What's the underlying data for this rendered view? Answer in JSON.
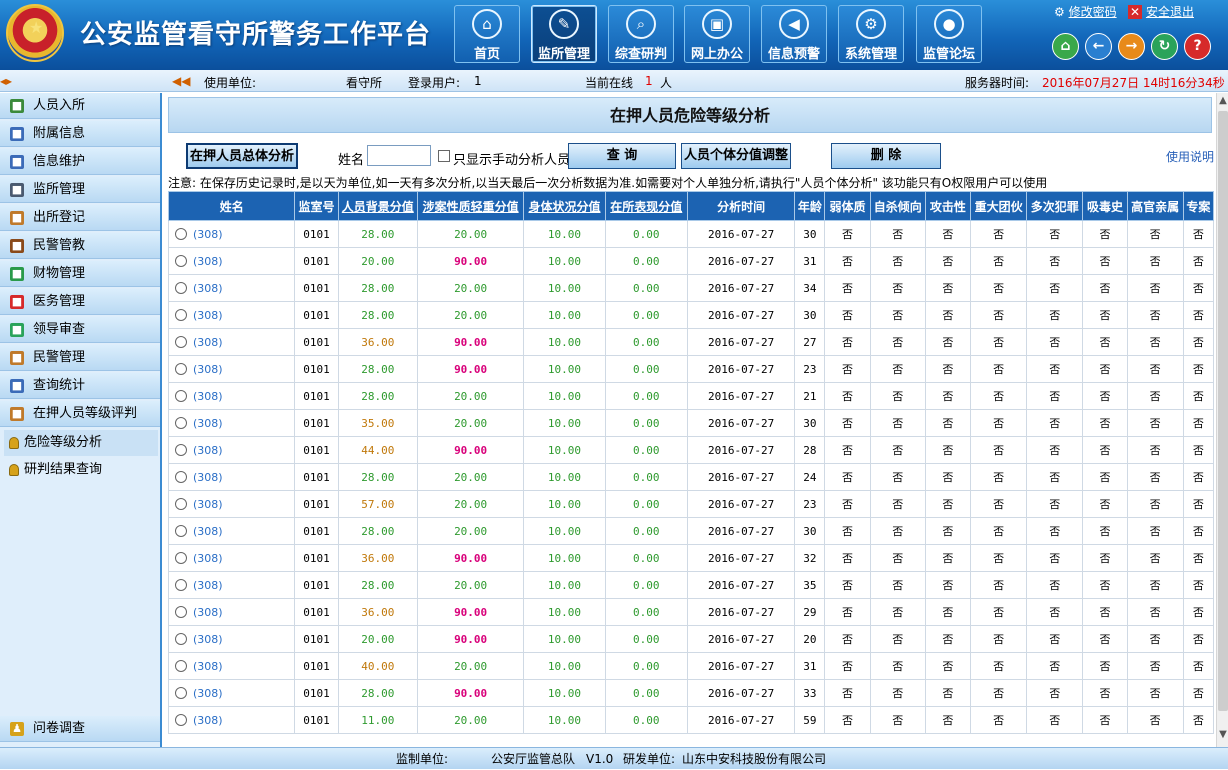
{
  "header": {
    "title": "公安监管看守所警务工作平台",
    "nav": [
      {
        "label": "首页",
        "icon": "home-icon",
        "glyph": "⌂",
        "active": false
      },
      {
        "label": "监所管理",
        "icon": "quill-icon",
        "glyph": "✎",
        "active": true
      },
      {
        "label": "综查研判",
        "icon": "magnifier-icon",
        "glyph": "⌕",
        "active": false
      },
      {
        "label": "网上办公",
        "icon": "monitor-icon",
        "glyph": "▣",
        "active": false
      },
      {
        "label": "信息预警",
        "icon": "alert-icon",
        "glyph": "◀",
        "active": false
      },
      {
        "label": "系统管理",
        "icon": "gear-icon",
        "glyph": "⚙",
        "active": false
      },
      {
        "label": "监管论坛",
        "icon": "speech-icon",
        "glyph": "●",
        "active": false
      }
    ],
    "change_password": "修改密码",
    "logout": "安全退出",
    "tools": [
      {
        "name": "home-tool-icon",
        "glyph": "⌂",
        "color": "#3aa84a"
      },
      {
        "name": "back-tool-icon",
        "glyph": "←",
        "color": "#2a7fd0"
      },
      {
        "name": "forward-tool-icon",
        "glyph": "→",
        "color": "#e88a1a"
      },
      {
        "name": "refresh-tool-icon",
        "glyph": "↻",
        "color": "#2aa35a"
      },
      {
        "name": "help-tool-icon",
        "glyph": "?",
        "color": "#d62a2a"
      }
    ]
  },
  "infobar": {
    "unit_label": "使用单位:",
    "unit_value": "看守所",
    "user_label": "登录用户:",
    "user_value": "1",
    "online_label": "当前在线",
    "online_count": "1",
    "online_unit": "人",
    "server_time_label": "服务器时间:",
    "server_time_value": "2016年07月27日 14时16分34秒"
  },
  "sidebar": {
    "items": [
      {
        "label": "人员入所",
        "icon": "person-add-icon",
        "color": "#3b8a3b"
      },
      {
        "label": "附属信息",
        "icon": "document-icon",
        "color": "#3b6bb8"
      },
      {
        "label": "信息维护",
        "icon": "contact-card-icon",
        "color": "#3b6bb8"
      },
      {
        "label": "监所管理",
        "icon": "monitor-icon",
        "color": "#4a5a70"
      },
      {
        "label": "出所登记",
        "icon": "edit-icon",
        "color": "#c07a2a"
      },
      {
        "label": "民警管教",
        "icon": "officer-icon",
        "color": "#8a4a1a"
      },
      {
        "label": "财物管理",
        "icon": "money-icon",
        "color": "#2a9a4a"
      },
      {
        "label": "医务管理",
        "icon": "medical-icon",
        "color": "#d62a2a"
      },
      {
        "label": "领导审查",
        "icon": "check-icon",
        "color": "#2aa35a"
      },
      {
        "label": "民警管理",
        "icon": "people-icon",
        "color": "#c07a2a"
      },
      {
        "label": "查询统计",
        "icon": "search-report-icon",
        "color": "#3b6bb8"
      },
      {
        "label": "在押人员等级评判",
        "icon": "rating-icon",
        "color": "#c07a2a"
      }
    ],
    "sub_items": [
      {
        "label": "危险等级分析",
        "selected": true
      },
      {
        "label": "研判结果查询",
        "selected": false
      }
    ],
    "bottom_item": {
      "label": "问卷调查",
      "icon": "person-icon",
      "color": "#d6a21a"
    }
  },
  "main": {
    "title": "在押人员危险等级分析",
    "overall_button": "在押人员总体分析",
    "name_label": "姓名",
    "name_value": "",
    "manual_checkbox_label": "只显示手动分析人员",
    "query_button": "查    询",
    "individual_button": "人员个体分值调整",
    "delete_button": "删    除",
    "help_link": "使用说明",
    "notice": "注意: 在保存历史记录时,是以天为单位,如一天有多次分析,以当天最后一次分析数据为准.如需要对个人单独分析,请执行\"人员个体分析\"    该功能只有O权限用户可以使用"
  },
  "table": {
    "columns": [
      "姓名",
      "监室号",
      "人员背景分值",
      "涉案性质轻重分值",
      "身体状况分值",
      "在所表现分值",
      "分析时间",
      "年龄",
      "弱体质",
      "自杀倾向",
      "攻击性",
      "重大团伙",
      "多次犯罪",
      "吸毒史",
      "高官亲属",
      "专案"
    ],
    "rows": [
      {
        "name": "(308)",
        "cell": "0101",
        "background": "28.00",
        "case": "20.00",
        "health": "10.00",
        "behavior": "0.00",
        "date": "2016-07-27",
        "age": "30",
        "flags": [
          "否",
          "否",
          "否",
          "否",
          "否",
          "否",
          "否",
          "否"
        ]
      },
      {
        "name": "(308)",
        "cell": "0101",
        "background": "20.00",
        "case": "90.00",
        "health": "10.00",
        "behavior": "0.00",
        "date": "2016-07-27",
        "age": "31",
        "flags": [
          "否",
          "否",
          "否",
          "否",
          "否",
          "否",
          "否",
          "否"
        ]
      },
      {
        "name": "(308)",
        "cell": "0101",
        "background": "28.00",
        "case": "20.00",
        "health": "10.00",
        "behavior": "0.00",
        "date": "2016-07-27",
        "age": "34",
        "flags": [
          "否",
          "否",
          "否",
          "否",
          "否",
          "否",
          "否",
          "否"
        ]
      },
      {
        "name": "(308)",
        "cell": "0101",
        "background": "28.00",
        "case": "20.00",
        "health": "10.00",
        "behavior": "0.00",
        "date": "2016-07-27",
        "age": "30",
        "flags": [
          "否",
          "否",
          "否",
          "否",
          "否",
          "否",
          "否",
          "否"
        ]
      },
      {
        "name": "(308)",
        "cell": "0101",
        "background": "36.00",
        "case": "90.00",
        "health": "10.00",
        "behavior": "0.00",
        "date": "2016-07-27",
        "age": "27",
        "flags": [
          "否",
          "否",
          "否",
          "否",
          "否",
          "否",
          "否",
          "否"
        ]
      },
      {
        "name": "(308)",
        "cell": "0101",
        "background": "28.00",
        "case": "90.00",
        "health": "10.00",
        "behavior": "0.00",
        "date": "2016-07-27",
        "age": "23",
        "flags": [
          "否",
          "否",
          "否",
          "否",
          "否",
          "否",
          "否",
          "否"
        ]
      },
      {
        "name": "(308)",
        "cell": "0101",
        "background": "28.00",
        "case": "20.00",
        "health": "10.00",
        "behavior": "0.00",
        "date": "2016-07-27",
        "age": "21",
        "flags": [
          "否",
          "否",
          "否",
          "否",
          "否",
          "否",
          "否",
          "否"
        ]
      },
      {
        "name": "(308)",
        "cell": "0101",
        "background": "35.00",
        "case": "20.00",
        "health": "10.00",
        "behavior": "0.00",
        "date": "2016-07-27",
        "age": "30",
        "flags": [
          "否",
          "否",
          "否",
          "否",
          "否",
          "否",
          "否",
          "否"
        ]
      },
      {
        "name": "(308)",
        "cell": "0101",
        "background": "44.00",
        "case": "90.00",
        "health": "10.00",
        "behavior": "0.00",
        "date": "2016-07-27",
        "age": "28",
        "flags": [
          "否",
          "否",
          "否",
          "否",
          "否",
          "否",
          "否",
          "否"
        ]
      },
      {
        "name": "(308)",
        "cell": "0101",
        "background": "28.00",
        "case": "20.00",
        "health": "10.00",
        "behavior": "0.00",
        "date": "2016-07-27",
        "age": "24",
        "flags": [
          "否",
          "否",
          "否",
          "否",
          "否",
          "否",
          "否",
          "否"
        ]
      },
      {
        "name": "(308)",
        "cell": "0101",
        "background": "57.00",
        "case": "20.00",
        "health": "10.00",
        "behavior": "0.00",
        "date": "2016-07-27",
        "age": "23",
        "flags": [
          "否",
          "否",
          "否",
          "否",
          "否",
          "否",
          "否",
          "否"
        ]
      },
      {
        "name": "(308)",
        "cell": "0101",
        "background": "28.00",
        "case": "20.00",
        "health": "10.00",
        "behavior": "0.00",
        "date": "2016-07-27",
        "age": "30",
        "flags": [
          "否",
          "否",
          "否",
          "否",
          "否",
          "否",
          "否",
          "否"
        ]
      },
      {
        "name": "(308)",
        "cell": "0101",
        "background": "36.00",
        "case": "90.00",
        "health": "10.00",
        "behavior": "0.00",
        "date": "2016-07-27",
        "age": "32",
        "flags": [
          "否",
          "否",
          "否",
          "否",
          "否",
          "否",
          "否",
          "否"
        ]
      },
      {
        "name": "(308)",
        "cell": "0101",
        "background": "28.00",
        "case": "20.00",
        "health": "10.00",
        "behavior": "0.00",
        "date": "2016-07-27",
        "age": "35",
        "flags": [
          "否",
          "否",
          "否",
          "否",
          "否",
          "否",
          "否",
          "否"
        ]
      },
      {
        "name": "(308)",
        "cell": "0101",
        "background": "36.00",
        "case": "90.00",
        "health": "10.00",
        "behavior": "0.00",
        "date": "2016-07-27",
        "age": "29",
        "flags": [
          "否",
          "否",
          "否",
          "否",
          "否",
          "否",
          "否",
          "否"
        ]
      },
      {
        "name": "(308)",
        "cell": "0101",
        "background": "20.00",
        "case": "90.00",
        "health": "10.00",
        "behavior": "0.00",
        "date": "2016-07-27",
        "age": "20",
        "flags": [
          "否",
          "否",
          "否",
          "否",
          "否",
          "否",
          "否",
          "否"
        ]
      },
      {
        "name": "(308)",
        "cell": "0101",
        "background": "40.00",
        "case": "20.00",
        "health": "10.00",
        "behavior": "0.00",
        "date": "2016-07-27",
        "age": "31",
        "flags": [
          "否",
          "否",
          "否",
          "否",
          "否",
          "否",
          "否",
          "否"
        ]
      },
      {
        "name": "(308)",
        "cell": "0101",
        "background": "28.00",
        "case": "90.00",
        "health": "10.00",
        "behavior": "0.00",
        "date": "2016-07-27",
        "age": "33",
        "flags": [
          "否",
          "否",
          "否",
          "否",
          "否",
          "否",
          "否",
          "否"
        ]
      },
      {
        "name": "(308)",
        "cell": "0101",
        "background": "11.00",
        "case": "20.00",
        "health": "10.00",
        "behavior": "0.00",
        "date": "2016-07-27",
        "age": "59",
        "flags": [
          "否",
          "否",
          "否",
          "否",
          "否",
          "否",
          "否",
          "否"
        ]
      }
    ]
  },
  "footer": {
    "supervisor_label": "监制单位:",
    "supervisor_value": "公安厅监管总队",
    "version": "V1.0",
    "developer_label": "研发单位:",
    "developer_value": "山东中安科技股份有限公司"
  },
  "colors": {
    "header_blue": "#1266b9",
    "table_header": "#1c63b2",
    "score_green": "#2e9a2e",
    "score_orange": "#c0780a",
    "score_high": "#d8007a",
    "server_time": "#e00000"
  }
}
